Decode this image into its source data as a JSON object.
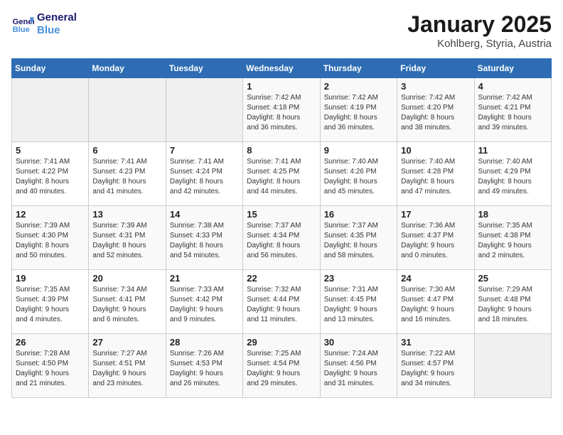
{
  "header": {
    "logo_line1": "General",
    "logo_line2": "Blue",
    "month": "January 2025",
    "location": "Kohlberg, Styria, Austria"
  },
  "weekdays": [
    "Sunday",
    "Monday",
    "Tuesday",
    "Wednesday",
    "Thursday",
    "Friday",
    "Saturday"
  ],
  "weeks": [
    [
      {
        "day": "",
        "detail": ""
      },
      {
        "day": "",
        "detail": ""
      },
      {
        "day": "",
        "detail": ""
      },
      {
        "day": "1",
        "detail": "Sunrise: 7:42 AM\nSunset: 4:18 PM\nDaylight: 8 hours\nand 36 minutes."
      },
      {
        "day": "2",
        "detail": "Sunrise: 7:42 AM\nSunset: 4:19 PM\nDaylight: 8 hours\nand 36 minutes."
      },
      {
        "day": "3",
        "detail": "Sunrise: 7:42 AM\nSunset: 4:20 PM\nDaylight: 8 hours\nand 38 minutes."
      },
      {
        "day": "4",
        "detail": "Sunrise: 7:42 AM\nSunset: 4:21 PM\nDaylight: 8 hours\nand 39 minutes."
      }
    ],
    [
      {
        "day": "5",
        "detail": "Sunrise: 7:41 AM\nSunset: 4:22 PM\nDaylight: 8 hours\nand 40 minutes."
      },
      {
        "day": "6",
        "detail": "Sunrise: 7:41 AM\nSunset: 4:23 PM\nDaylight: 8 hours\nand 41 minutes."
      },
      {
        "day": "7",
        "detail": "Sunrise: 7:41 AM\nSunset: 4:24 PM\nDaylight: 8 hours\nand 42 minutes."
      },
      {
        "day": "8",
        "detail": "Sunrise: 7:41 AM\nSunset: 4:25 PM\nDaylight: 8 hours\nand 44 minutes."
      },
      {
        "day": "9",
        "detail": "Sunrise: 7:40 AM\nSunset: 4:26 PM\nDaylight: 8 hours\nand 45 minutes."
      },
      {
        "day": "10",
        "detail": "Sunrise: 7:40 AM\nSunset: 4:28 PM\nDaylight: 8 hours\nand 47 minutes."
      },
      {
        "day": "11",
        "detail": "Sunrise: 7:40 AM\nSunset: 4:29 PM\nDaylight: 8 hours\nand 49 minutes."
      }
    ],
    [
      {
        "day": "12",
        "detail": "Sunrise: 7:39 AM\nSunset: 4:30 PM\nDaylight: 8 hours\nand 50 minutes."
      },
      {
        "day": "13",
        "detail": "Sunrise: 7:39 AM\nSunset: 4:31 PM\nDaylight: 8 hours\nand 52 minutes."
      },
      {
        "day": "14",
        "detail": "Sunrise: 7:38 AM\nSunset: 4:33 PM\nDaylight: 8 hours\nand 54 minutes."
      },
      {
        "day": "15",
        "detail": "Sunrise: 7:37 AM\nSunset: 4:34 PM\nDaylight: 8 hours\nand 56 minutes."
      },
      {
        "day": "16",
        "detail": "Sunrise: 7:37 AM\nSunset: 4:35 PM\nDaylight: 8 hours\nand 58 minutes."
      },
      {
        "day": "17",
        "detail": "Sunrise: 7:36 AM\nSunset: 4:37 PM\nDaylight: 9 hours\nand 0 minutes."
      },
      {
        "day": "18",
        "detail": "Sunrise: 7:35 AM\nSunset: 4:38 PM\nDaylight: 9 hours\nand 2 minutes."
      }
    ],
    [
      {
        "day": "19",
        "detail": "Sunrise: 7:35 AM\nSunset: 4:39 PM\nDaylight: 9 hours\nand 4 minutes."
      },
      {
        "day": "20",
        "detail": "Sunrise: 7:34 AM\nSunset: 4:41 PM\nDaylight: 9 hours\nand 6 minutes."
      },
      {
        "day": "21",
        "detail": "Sunrise: 7:33 AM\nSunset: 4:42 PM\nDaylight: 9 hours\nand 9 minutes."
      },
      {
        "day": "22",
        "detail": "Sunrise: 7:32 AM\nSunset: 4:44 PM\nDaylight: 9 hours\nand 11 minutes."
      },
      {
        "day": "23",
        "detail": "Sunrise: 7:31 AM\nSunset: 4:45 PM\nDaylight: 9 hours\nand 13 minutes."
      },
      {
        "day": "24",
        "detail": "Sunrise: 7:30 AM\nSunset: 4:47 PM\nDaylight: 9 hours\nand 16 minutes."
      },
      {
        "day": "25",
        "detail": "Sunrise: 7:29 AM\nSunset: 4:48 PM\nDaylight: 9 hours\nand 18 minutes."
      }
    ],
    [
      {
        "day": "26",
        "detail": "Sunrise: 7:28 AM\nSunset: 4:50 PM\nDaylight: 9 hours\nand 21 minutes."
      },
      {
        "day": "27",
        "detail": "Sunrise: 7:27 AM\nSunset: 4:51 PM\nDaylight: 9 hours\nand 23 minutes."
      },
      {
        "day": "28",
        "detail": "Sunrise: 7:26 AM\nSunset: 4:53 PM\nDaylight: 9 hours\nand 26 minutes."
      },
      {
        "day": "29",
        "detail": "Sunrise: 7:25 AM\nSunset: 4:54 PM\nDaylight: 9 hours\nand 29 minutes."
      },
      {
        "day": "30",
        "detail": "Sunrise: 7:24 AM\nSunset: 4:56 PM\nDaylight: 9 hours\nand 31 minutes."
      },
      {
        "day": "31",
        "detail": "Sunrise: 7:22 AM\nSunset: 4:57 PM\nDaylight: 9 hours\nand 34 minutes."
      },
      {
        "day": "",
        "detail": ""
      }
    ]
  ]
}
